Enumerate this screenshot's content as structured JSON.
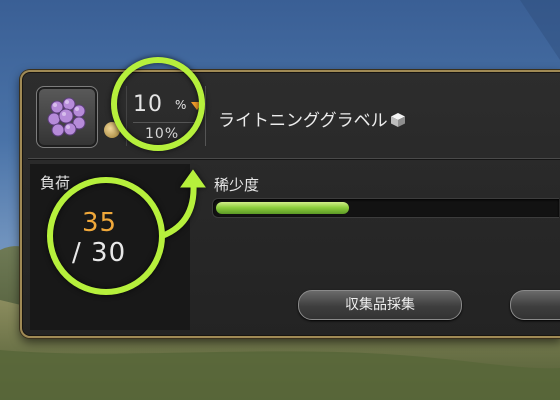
{
  "window": {
    "item": {
      "icon": "lightning-gravel-icon",
      "hq_icon": "hq-mark-icon"
    },
    "chance": {
      "value": "10",
      "unit": "%",
      "sub_value": "10%",
      "arrow_icon": "down-arrow-icon",
      "arrow_color": "#f29c2a"
    },
    "item_name": "ライトニンググラベル",
    "collectable_icon": "collectable-cube-icon",
    "load": {
      "label": "負荷",
      "current": "35",
      "max": "/ 30",
      "current_color": "#f0a83a"
    },
    "rarity": {
      "label": "稀少度",
      "fill_fraction": 0.39,
      "fill_color": "#8fcf3e"
    },
    "actions": {
      "collect_button": "収集品採集"
    }
  },
  "annotation": {
    "circle_color": "#b6f03c"
  }
}
